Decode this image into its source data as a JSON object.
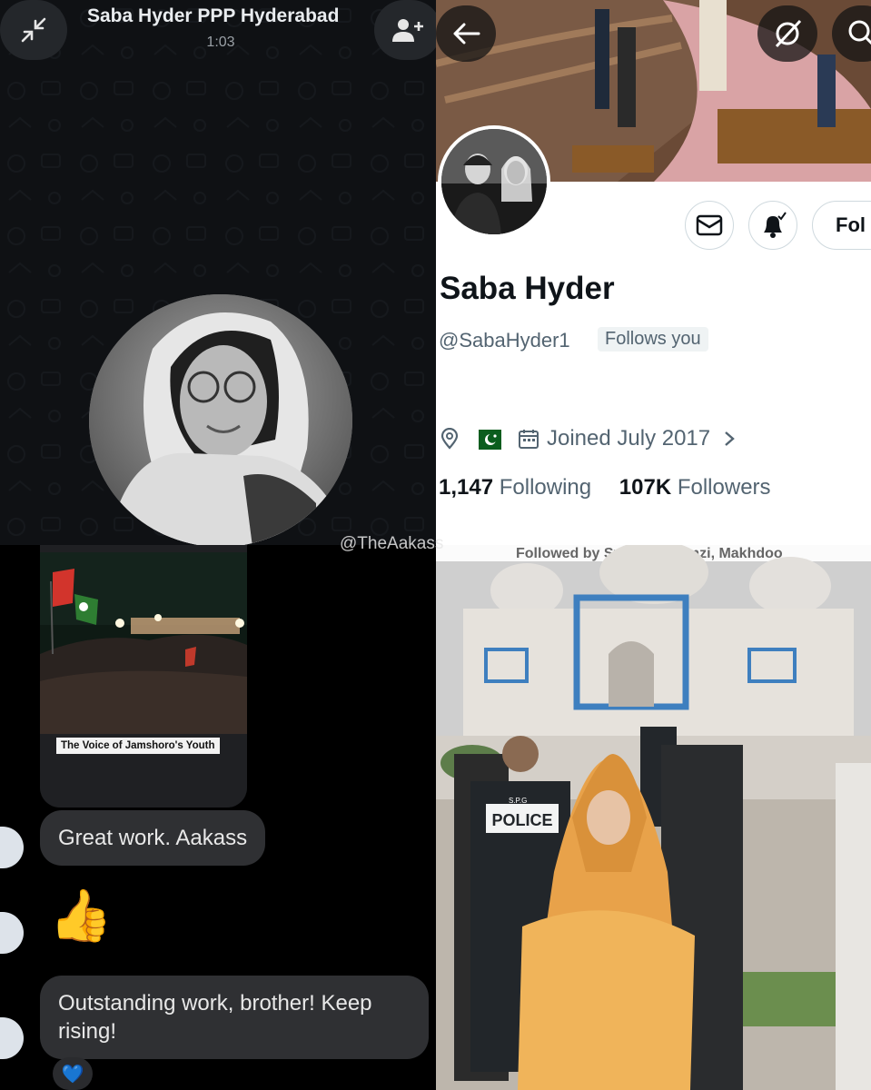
{
  "call": {
    "contact_name": "Saba Hyder PPP Hyderabad",
    "timer": "1:03"
  },
  "profile": {
    "display_name": "Saba Hyder",
    "handle": "@SabaHyder1",
    "follows_you": "Follows you",
    "joined": "Joined July 2017",
    "following_count": "1,147",
    "following_label": "Following",
    "followers_count": "107K",
    "followers_label": "Followers",
    "follow_button": "Fol",
    "followed_by": "Followed by Syed Aly Trimzi, Makhdoo"
  },
  "chat": {
    "media_caption": "The Voice of Jamshoro's Youth",
    "messages": [
      {
        "text": "Great work. Aakass"
      },
      {
        "emoji": "👍"
      },
      {
        "text": "Outstanding work, brother! Keep rising!"
      }
    ],
    "reaction": "💙"
  },
  "photo": {
    "police_label": "POLICE",
    "spg_label": "S.P.G"
  },
  "watermark": "@TheAakass",
  "colors": {
    "call_bg": "#0f1114",
    "profile_text": "#0f1419",
    "profile_secondary": "#536471",
    "chat_bubble": "#2f3033"
  },
  "icons": [
    "minimize-icon",
    "add-person-icon",
    "back-arrow-icon",
    "sync-off-icon",
    "search-icon",
    "mail-icon",
    "bell-icon",
    "location-icon",
    "pakistan-flag-icon",
    "calendar-icon",
    "chevron-right-icon"
  ]
}
